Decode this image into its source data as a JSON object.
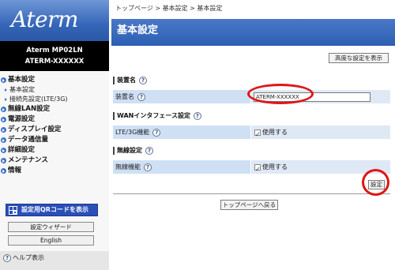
{
  "brand": {
    "logo": "Aterm",
    "model_line1": "Aterm   MP02LN",
    "model_line2": "ATERM-XXXXXX"
  },
  "sidebar": {
    "menu": [
      {
        "type": "head",
        "label": "基本設定"
      },
      {
        "type": "sub",
        "label": "基本設定"
      },
      {
        "type": "sub",
        "label": "接続先設定(LTE/3G)"
      },
      {
        "type": "head",
        "label": "無線LAN設定"
      },
      {
        "type": "head",
        "label": "電源設定"
      },
      {
        "type": "head",
        "label": "ディスプレイ設定"
      },
      {
        "type": "head",
        "label": "データ通信量"
      },
      {
        "type": "head",
        "label": "詳細設定"
      },
      {
        "type": "head",
        "label": "メンテナンス"
      },
      {
        "type": "head",
        "label": "情報"
      }
    ],
    "qr_button": "設定用QRコードを表示",
    "wizard_button": "設定ウィザード",
    "english_button": "English",
    "help_label": "ヘルプ表示"
  },
  "breadcrumb": "トップページ > 基本設定 > 基本設定",
  "page_title": "基本設定",
  "advanced_button": "高度な設定を表示",
  "sections": {
    "device": {
      "title": "装置名",
      "row_label": "装置名",
      "value": "ATERM-XXXXXX"
    },
    "wan": {
      "title": "WANインタフェース設定",
      "row_label": "LTE/3G機能",
      "value": "使用する"
    },
    "wireless": {
      "title": "無線設定",
      "row_label": "無線機能",
      "value": "使用する"
    }
  },
  "help_glyph": "?",
  "setting_button": "設定",
  "top_page_button": "トップページへ戻る",
  "accent_colors": {
    "header_blue": "#2c5fb3",
    "highlight_ring": "#e01515",
    "row_label_bg": "#cfe0f5"
  }
}
